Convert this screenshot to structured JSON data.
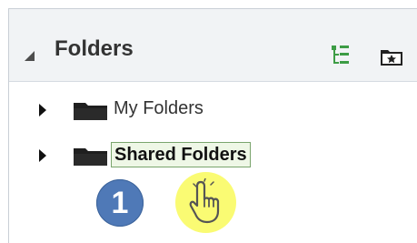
{
  "panel": {
    "title": "Folders",
    "items": [
      {
        "label": "My Folders"
      },
      {
        "label": "Shared Folders"
      }
    ]
  },
  "overlay": {
    "step_number": "1"
  },
  "colors": {
    "header_bg": "#f1f3f5",
    "tree_icon": "#3d9c45",
    "folder": "#1f1f1f",
    "highlight_border": "#7aa56d",
    "highlight_fill": "#eef7e6",
    "badge": "#4f79b7",
    "pointer_circle": "#fafb73"
  },
  "icons": {
    "collapse": "triangle-collapse-icon",
    "tree": "tree-view-icon",
    "favorite_folder": "favorite-folder-icon",
    "expander": "expand-arrow-icon",
    "folder": "folder-icon",
    "pointer": "hand-pointer-icon"
  }
}
